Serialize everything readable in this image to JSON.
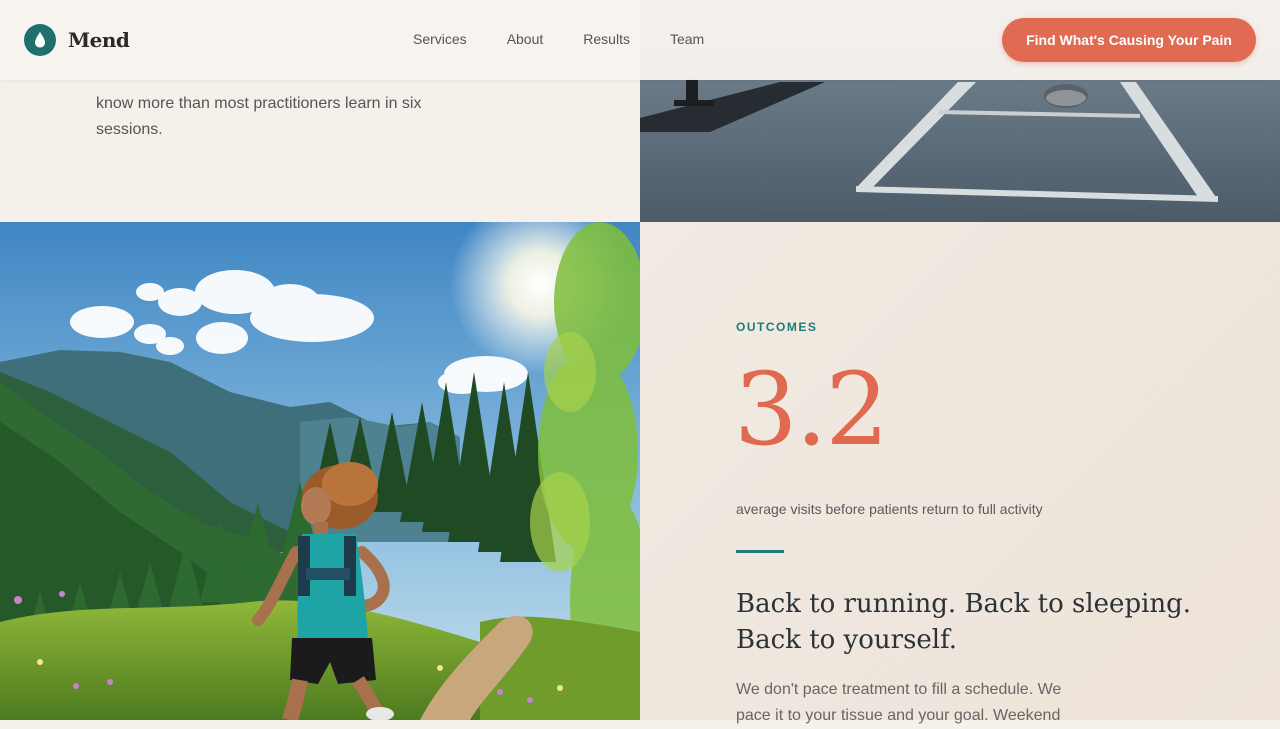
{
  "nav": {
    "brand": "Mend",
    "links": [
      "Services",
      "About",
      "Results",
      "Team"
    ],
    "cta": "Find What's Causing Your Pain"
  },
  "intro": {
    "text": "know more than most practitioners learn in six sessions."
  },
  "outcomes": {
    "eyebrow": "OUTCOMES",
    "stat": "3.2",
    "stat_label": "average visits before patients return to full activity",
    "headline": "Back to running. Back to sleeping. Back to yourself.",
    "body": "We don't pace treatment to fill a schedule. We pace it to your tissue and your goal. Weekend"
  },
  "colors": {
    "accent": "#e06a52",
    "teal": "#1f7a7a",
    "background": "#f5f0ea"
  },
  "icons": {
    "brand": "water-drop-icon"
  }
}
